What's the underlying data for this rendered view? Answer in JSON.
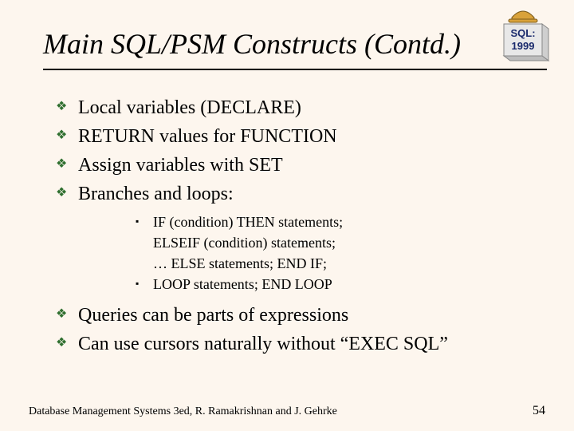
{
  "title": "Main SQL/PSM Constructs (Contd.)",
  "logo": {
    "line1": "SQL:",
    "line2": "1999"
  },
  "bullets": {
    "b0": "Local variables (DECLARE)",
    "b1": "RETURN values for FUNCTION",
    "b2": "Assign variables with SET",
    "b3": "Branches and loops:",
    "s0a": "IF (condition) THEN statements;",
    "s0b": "ELSEIF (condition) statements;",
    "s0c": "… ELSE statements; END IF;",
    "s1": "LOOP statements; END LOOP",
    "b4": "Queries can be parts of expressions",
    "b5": "Can use cursors naturally without “EXEC SQL”"
  },
  "footer": {
    "left": "Database Management Systems 3ed,  R. Ramakrishnan and J. Gehrke",
    "right": "54"
  },
  "glyphs": {
    "diamond": "❖",
    "square": "▪"
  }
}
